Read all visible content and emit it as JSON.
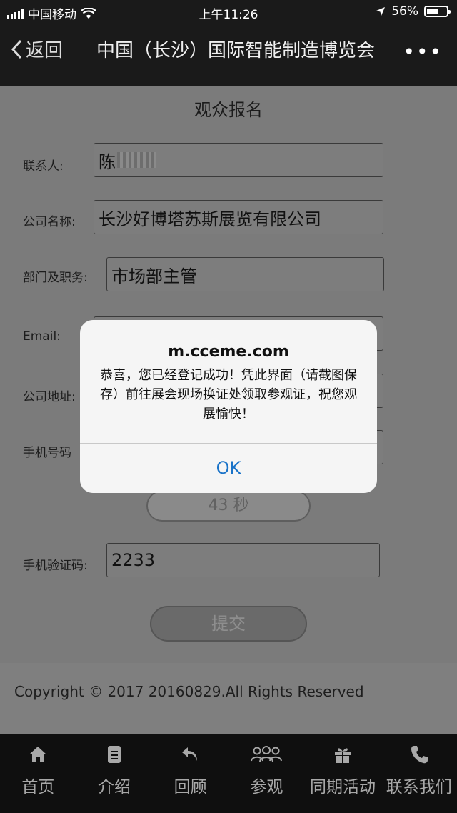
{
  "status_bar": {
    "carrier": "中国移动",
    "time": "上午11:26",
    "battery": "56%",
    "battery_level": 0.56
  },
  "navbar": {
    "back_label": "返回",
    "title": "中国（长沙）国际智能制造博览会",
    "more_label": "•••"
  },
  "form": {
    "title": "观众报名",
    "contact_label": "联系人:",
    "contact_value": "陈",
    "company_label": "公司名称:",
    "company_value": "长沙好博塔苏斯展览有限公司",
    "dept_label": "部门及职务:",
    "dept_value": "市场部主管",
    "email_label": "Email:",
    "address_label": "公司地址:",
    "phone_label": "手机号码",
    "timer_label": "43 秒",
    "code_label": "手机验证码:",
    "code_value": "2233",
    "submit_label": "提交"
  },
  "copyright": "Copyright © 2017 20160829.All Rights Reserved",
  "tabs": [
    {
      "label": "首页",
      "icon": "home-icon"
    },
    {
      "label": "介绍",
      "icon": "document-icon"
    },
    {
      "label": "回顾",
      "icon": "reply-icon"
    },
    {
      "label": "参观",
      "icon": "people-icon"
    },
    {
      "label": "同期活动",
      "icon": "gift-icon"
    },
    {
      "label": "联系我们",
      "icon": "phone-icon"
    }
  ],
  "alert": {
    "title": "m.cceme.com",
    "message": "恭喜，您已经登记成功！凭此界面（请截图保存）前往展会现场换证处领取参观证，祝您观展愉快！",
    "ok_label": "OK"
  }
}
